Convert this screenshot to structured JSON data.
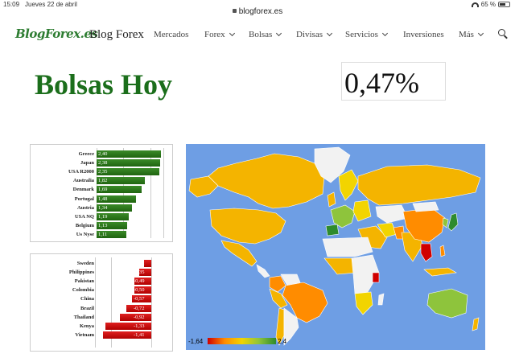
{
  "status_bar": {
    "time": "15:09",
    "date": "Jueves 22 de abril",
    "url": "blogforex.es",
    "battery": "65 %",
    "battery_level": 0.65
  },
  "nav": {
    "logo": "BlogForex.es",
    "site_name": "Blog Forex",
    "items": [
      {
        "label": "Mercados",
        "dropdown": false
      },
      {
        "label": "Forex",
        "dropdown": true
      },
      {
        "label": "Bolsas",
        "dropdown": true
      },
      {
        "label": "Divisas",
        "dropdown": true
      },
      {
        "label": "Servicios",
        "dropdown": true
      },
      {
        "label": "Inversiones",
        "dropdown": false
      },
      {
        "label": "Más",
        "dropdown": true
      }
    ],
    "search_icon": "search-icon"
  },
  "page": {
    "title": "Bolsas Hoy",
    "change": "0,47%"
  },
  "top_markets": {
    "items": [
      {
        "country": "Greece",
        "value": 2.4,
        "label": "2,40"
      },
      {
        "country": "Japan",
        "value": 2.38,
        "label": "2,38"
      },
      {
        "country": "USA R2000",
        "value": 2.35,
        "label": "2,35"
      },
      {
        "country": "Australia",
        "value": 1.82,
        "label": "1,82"
      },
      {
        "country": "Denmark",
        "value": 1.69,
        "label": "1,69"
      },
      {
        "country": "Portugal",
        "value": 1.48,
        "label": "1,48"
      },
      {
        "country": "Austria",
        "value": 1.34,
        "label": "1,34"
      },
      {
        "country": "USA NQ",
        "value": 1.19,
        "label": "1,19"
      },
      {
        "country": "Belgium",
        "value": 1.13,
        "label": "1,13"
      },
      {
        "country": "Us Nyse",
        "value": 1.11,
        "label": "1,11"
      }
    ]
  },
  "bottom_markets": {
    "items": [
      {
        "country": "Sweden",
        "value": -0.22,
        "label": "-0,22"
      },
      {
        "country": "Philippines",
        "value": -0.35,
        "label": "-0,35"
      },
      {
        "country": "Pakistan",
        "value": -0.49,
        "label": "-0,49"
      },
      {
        "country": "Colombia",
        "value": -0.5,
        "label": "-0,50"
      },
      {
        "country": "China",
        "value": -0.57,
        "label": "-0,57"
      },
      {
        "country": "Brazil",
        "value": -0.72,
        "label": "-0,72"
      },
      {
        "country": "Thailand",
        "value": -0.92,
        "label": "-0,92"
      },
      {
        "country": "Kenya",
        "value": -1.33,
        "label": "-1,33"
      },
      {
        "country": "Vietnam",
        "value": -1.41,
        "label": "-1,41"
      }
    ]
  },
  "map": {
    "legend_min": "-1,64",
    "legend_max": "2,4",
    "colors": {
      "ocean": "#6e9ee4",
      "no_data": "#f2f2f2",
      "low": "#d00000",
      "mid_low": "#ff8c00",
      "mid": "#f2d400",
      "mid_high": "#8ec43c",
      "high": "#2e8b2e",
      "default": "#f4b400"
    }
  },
  "colors": {
    "brand_green": "#2e7d32",
    "title_green": "#1b6e1b",
    "bar_green": "#2b7a1c",
    "bar_red": "#c80000"
  }
}
